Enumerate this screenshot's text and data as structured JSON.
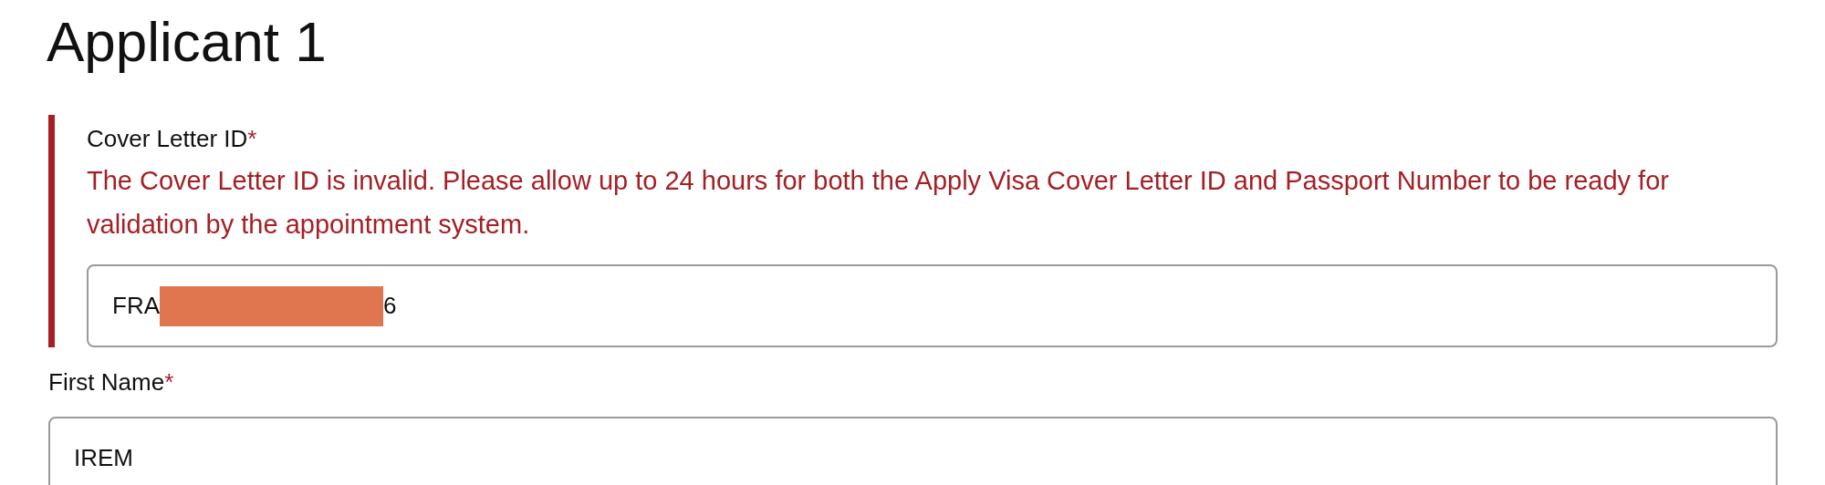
{
  "heading": "Applicant 1",
  "fields": [
    {
      "label": "Cover Letter ID",
      "required_mark": "*",
      "invalid": true,
      "error": "The Cover Letter ID is invalid. Please allow up to 24 hours for both the Apply Visa Cover Letter ID and Passport Number to be ready for validation by the appointment system.",
      "value_start": "FRA",
      "redacted": true,
      "value_end": "6"
    },
    {
      "label": "First Name",
      "required_mark": "*",
      "invalid": false,
      "value_start": "IREM",
      "redacted": false
    }
  ]
}
